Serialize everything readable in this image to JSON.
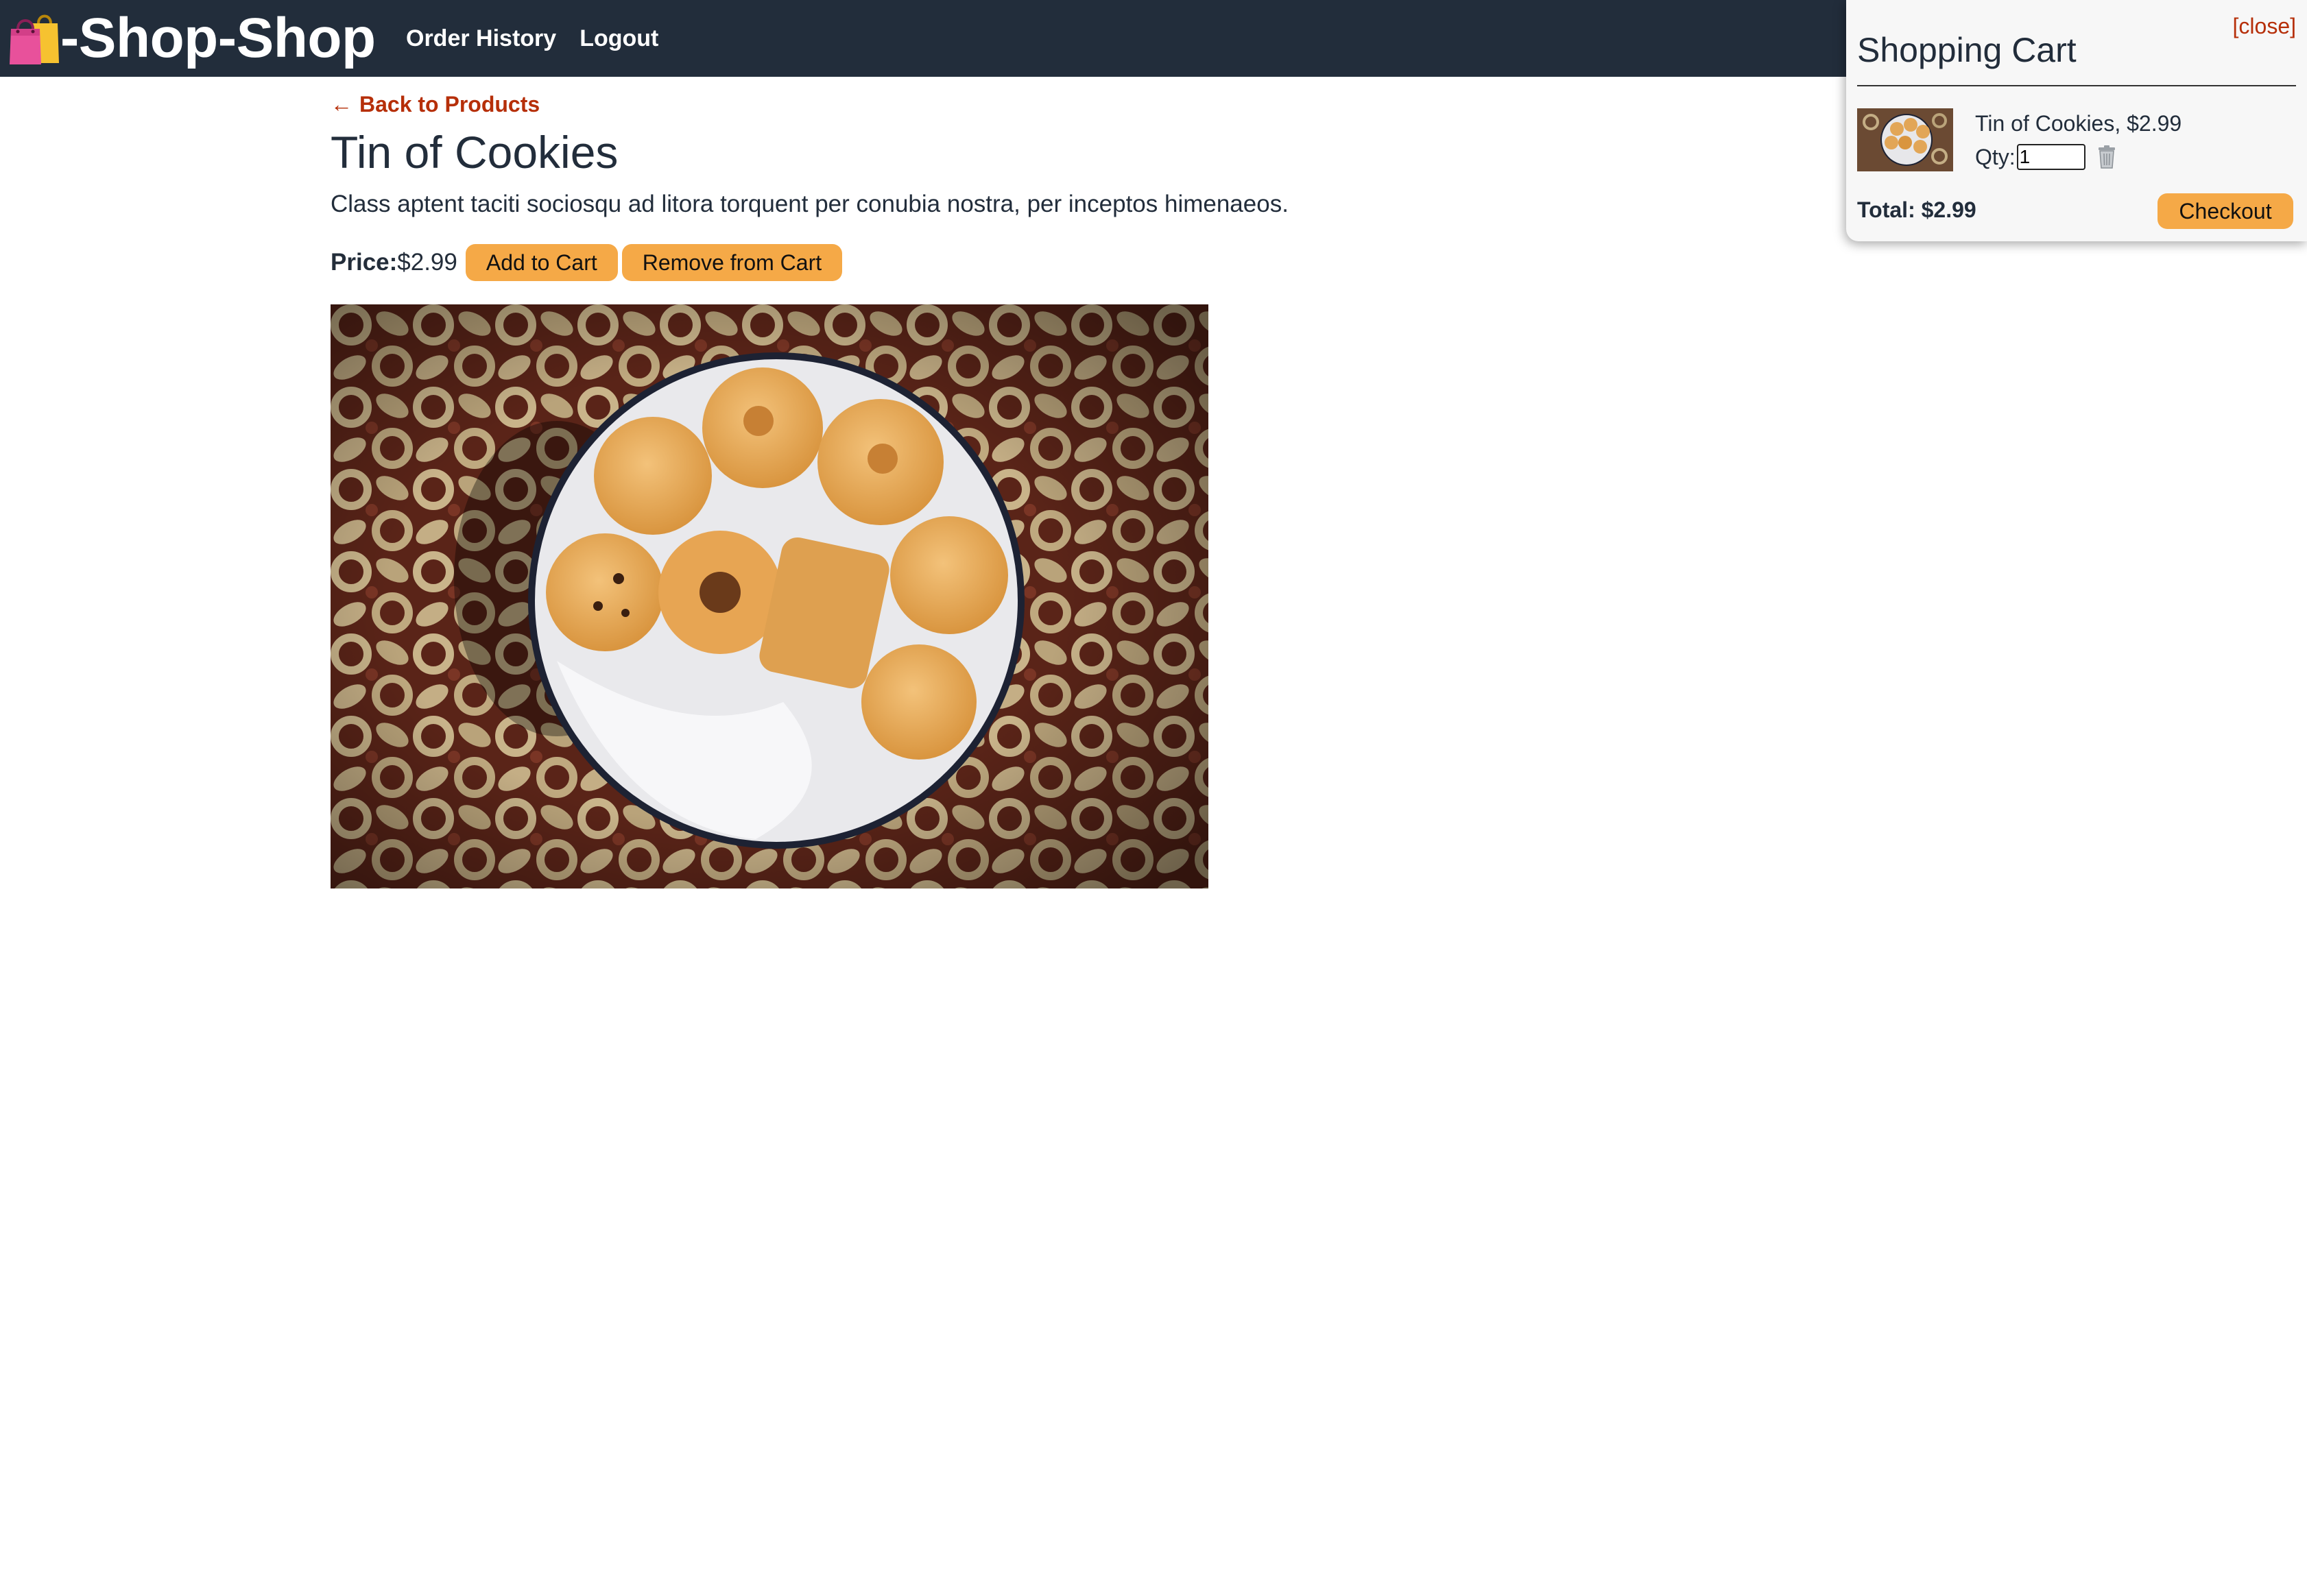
{
  "brand": {
    "icon": "shopping-bags-icon",
    "title": "-Shop-Shop"
  },
  "nav": {
    "order_history": "Order History",
    "logout": "Logout"
  },
  "product": {
    "back_arrow": "←",
    "back_label": "Back to Products",
    "title": "Tin of Cookies",
    "description": "Class aptent taciti sociosqu ad litora torquent per conubia nostra, per inceptos himenaeos.",
    "price_label": "Price:",
    "price_value": "$2.99",
    "add_label": "Add to Cart",
    "remove_label": "Remove from Cart",
    "image": "tin-of-cookies-photo"
  },
  "cart": {
    "close_label": "[close]",
    "title": "Shopping Cart",
    "items": [
      {
        "name_price": "Tin of Cookies, $2.99",
        "qty_label": "Qty:",
        "qty_value": "1",
        "trash_icon": "trash-icon",
        "thumb": "tin-of-cookies-thumbnail"
      }
    ],
    "total_label": "Total: $2.99",
    "checkout_label": "Checkout"
  },
  "colors": {
    "header_bg": "#222d3b",
    "accent_button": "#f5a947",
    "link_red": "#b62f09",
    "cart_bg": "#f7f7f7"
  }
}
